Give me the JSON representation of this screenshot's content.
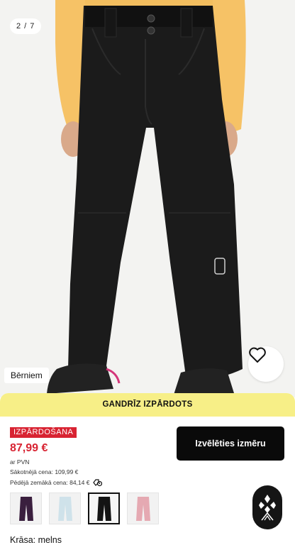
{
  "gallery": {
    "page_indicator": "2 / 7",
    "category_tag": "Bērniem"
  },
  "favorite": {
    "icon": "heart-outline-icon"
  },
  "banner": {
    "text": "GANDRĪZ IZPĀRDOTS"
  },
  "pricing": {
    "sale_badge": "IZPĀRDOŠANA",
    "price": "87,99 €",
    "vat_note": "ar PVN",
    "original_price": "Sākotnējā cena: 109,99 €",
    "lowest_price": "Pēdējā zemākā cena: 84,14 €",
    "info_icon": "price-history-icon"
  },
  "cta": {
    "label": "Izvēlēties izmēru"
  },
  "variants": {
    "swatches": [
      {
        "name": "dark-purple",
        "color": "#3a1f3e"
      },
      {
        "name": "light-blue",
        "color": "#cfe2ea"
      },
      {
        "name": "black",
        "color": "#141414",
        "selected": true
      },
      {
        "name": "pink",
        "color": "#e5a9b2"
      }
    ],
    "color_label": "Krāsa: melns"
  },
  "colors": {
    "accent_red": "#d82332",
    "banner_yellow": "#f7ef87",
    "cta_black": "#0a0a0a"
  }
}
